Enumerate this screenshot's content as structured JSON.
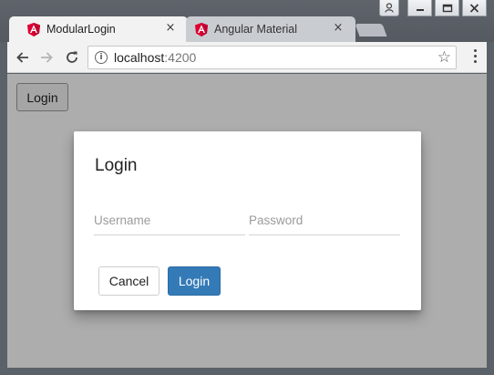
{
  "browser": {
    "tabs": [
      {
        "title": "ModularLogin",
        "active": true
      },
      {
        "title": "Angular Material",
        "active": false
      }
    ],
    "tab_close_glyph": "×",
    "url_host": "localhost",
    "url_port": ":4200",
    "icons": {
      "back": "back-arrow-icon",
      "forward": "forward-arrow-icon",
      "reload": "reload-icon",
      "info": "info-icon",
      "bookmark": "star-icon",
      "menu": "kebab-menu-icon",
      "tab_favicon": "angular-icon"
    }
  },
  "window_controls": {
    "user": "user-icon",
    "minimize": "minimize-icon",
    "maximize": "maximize-icon",
    "close": "close-icon"
  },
  "page": {
    "login_button_label": "Login"
  },
  "dialog": {
    "title": "Login",
    "username_placeholder": "Username",
    "password_placeholder": "Password",
    "username_value": "",
    "password_value": "",
    "cancel_label": "Cancel",
    "login_label": "Login"
  },
  "colors": {
    "primary": "#337ab7",
    "angular_red": "#dd0031",
    "backdrop": "rgba(0,0,0,0.32)"
  }
}
